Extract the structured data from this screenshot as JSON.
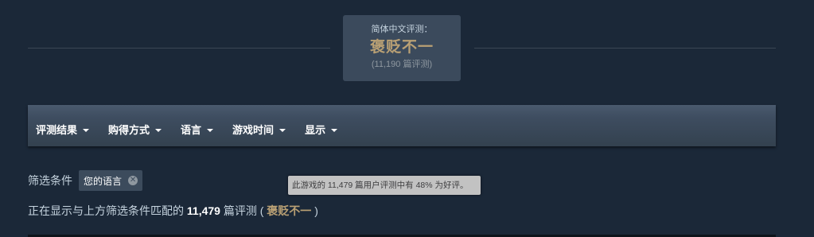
{
  "summary": {
    "title": "简体中文评测：",
    "rating": "褒贬不一",
    "count": "(11,190 篇评测)"
  },
  "filter_menus": [
    {
      "label": "评测结果"
    },
    {
      "label": "购得方式"
    },
    {
      "label": "语言"
    },
    {
      "label": "游戏时间"
    },
    {
      "label": "显示"
    }
  ],
  "active_filters": {
    "label": "筛选条件",
    "chip_label": "您的语言",
    "chip_close": "✕"
  },
  "tooltip": {
    "text": "此游戏的 11,479 篇用户评测中有 48% 为好评。"
  },
  "results": {
    "prefix": "正在显示与上方筛选条件匹配的",
    "count": "11,479",
    "middle": "篇评测 (",
    "rating": "褒贬不一",
    "suffix": ")"
  },
  "colors": {
    "background": "#1b2838",
    "mixed_rating": "#b9a074",
    "filter_bar": "#3e4d60"
  }
}
